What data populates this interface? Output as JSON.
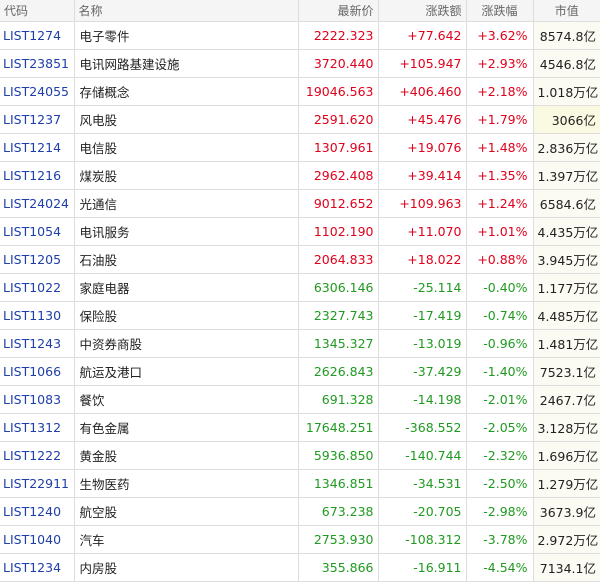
{
  "headers": {
    "code": "代码",
    "name": "名称",
    "last": "最新价",
    "change": "涨跌额",
    "pct": "涨跌幅",
    "cap": "市值"
  },
  "rows": [
    {
      "code": "LIST1274",
      "name": "电子零件",
      "last": "2222.323",
      "change": "+77.642",
      "pct": "+3.62%",
      "cap": "8574.8亿",
      "dir": "up"
    },
    {
      "code": "LIST23851",
      "name": "电讯网路基建设施",
      "last": "3720.440",
      "change": "+105.947",
      "pct": "+2.93%",
      "cap": "4546.8亿",
      "dir": "up"
    },
    {
      "code": "LIST24055",
      "name": "存储概念",
      "last": "19046.563",
      "change": "+406.460",
      "pct": "+2.18%",
      "cap": "1.018万亿",
      "dir": "up"
    },
    {
      "code": "LIST1237",
      "name": "风电股",
      "last": "2591.620",
      "change": "+45.476",
      "pct": "+1.79%",
      "cap": "3066亿",
      "dir": "up"
    },
    {
      "code": "LIST1214",
      "name": "电信股",
      "last": "1307.961",
      "change": "+19.076",
      "pct": "+1.48%",
      "cap": "2.836万亿",
      "dir": "up"
    },
    {
      "code": "LIST1216",
      "name": "煤炭股",
      "last": "2962.408",
      "change": "+39.414",
      "pct": "+1.35%",
      "cap": "1.397万亿",
      "dir": "up"
    },
    {
      "code": "LIST24024",
      "name": "光通信",
      "last": "9012.652",
      "change": "+109.963",
      "pct": "+1.24%",
      "cap": "6584.6亿",
      "dir": "up"
    },
    {
      "code": "LIST1054",
      "name": "电讯服务",
      "last": "1102.190",
      "change": "+11.070",
      "pct": "+1.01%",
      "cap": "4.435万亿",
      "dir": "up"
    },
    {
      "code": "LIST1205",
      "name": "石油股",
      "last": "2064.833",
      "change": "+18.022",
      "pct": "+0.88%",
      "cap": "3.945万亿",
      "dir": "up"
    },
    {
      "code": "LIST1022",
      "name": "家庭电器",
      "last": "6306.146",
      "change": "-25.114",
      "pct": "-0.40%",
      "cap": "1.177万亿",
      "dir": "down"
    },
    {
      "code": "LIST1130",
      "name": "保险股",
      "last": "2327.743",
      "change": "-17.419",
      "pct": "-0.74%",
      "cap": "4.485万亿",
      "dir": "down"
    },
    {
      "code": "LIST1243",
      "name": "中资券商股",
      "last": "1345.327",
      "change": "-13.019",
      "pct": "-0.96%",
      "cap": "1.481万亿",
      "dir": "down"
    },
    {
      "code": "LIST1066",
      "name": "航运及港口",
      "last": "2626.843",
      "change": "-37.429",
      "pct": "-1.40%",
      "cap": "7523.1亿",
      "dir": "down"
    },
    {
      "code": "LIST1083",
      "name": "餐饮",
      "last": "691.328",
      "change": "-14.198",
      "pct": "-2.01%",
      "cap": "2467.7亿",
      "dir": "down"
    },
    {
      "code": "LIST1312",
      "name": "有色金属",
      "last": "17648.251",
      "change": "-368.552",
      "pct": "-2.05%",
      "cap": "3.128万亿",
      "dir": "down"
    },
    {
      "code": "LIST1222",
      "name": "黄金股",
      "last": "5936.850",
      "change": "-140.744",
      "pct": "-2.32%",
      "cap": "1.696万亿",
      "dir": "down"
    },
    {
      "code": "LIST22911",
      "name": "生物医药",
      "last": "1346.851",
      "change": "-34.531",
      "pct": "-2.50%",
      "cap": "1.279万亿",
      "dir": "down"
    },
    {
      "code": "LIST1240",
      "name": "航空股",
      "last": "673.238",
      "change": "-20.705",
      "pct": "-2.98%",
      "cap": "3673.9亿",
      "dir": "down"
    },
    {
      "code": "LIST1040",
      "name": "汽车",
      "last": "2753.930",
      "change": "-108.312",
      "pct": "-3.78%",
      "cap": "2.972万亿",
      "dir": "down"
    },
    {
      "code": "LIST1234",
      "name": "内房股",
      "last": "355.866",
      "change": "-16.911",
      "pct": "-4.54%",
      "cap": "7134.1亿",
      "dir": "down"
    }
  ],
  "colors": {
    "up": "#e0001b",
    "down": "#1f9a1f",
    "code": "#1f3fa8"
  }
}
